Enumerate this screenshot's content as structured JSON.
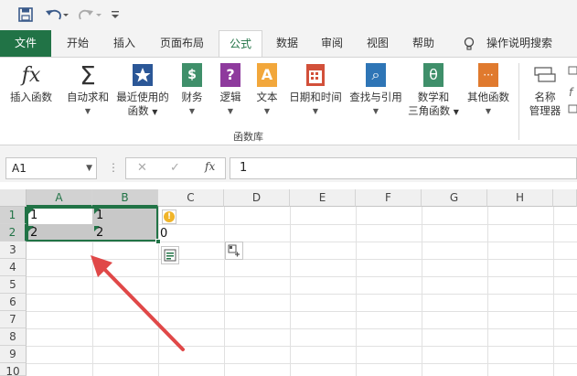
{
  "qat": {
    "save_icon": "save-icon",
    "undo_icon": "undo-icon",
    "redo_icon": "redo-icon",
    "customize_icon": "customize-qat-icon"
  },
  "tabs": {
    "file": "文件",
    "home": "开始",
    "insert": "插入",
    "page_layout": "页面布局",
    "formulas": "公式",
    "data": "数据",
    "review": "审阅",
    "view": "视图",
    "help": "帮助",
    "tell_me": "操作说明搜索"
  },
  "ribbon": {
    "insert_function": "插入函数",
    "autosum": "自动求和",
    "recent_line1": "最近使用的",
    "recent_line2": "函数",
    "financial": "财务",
    "logical": "逻辑",
    "text": "文本",
    "datetime": "日期和时间",
    "lookup": "查找与引用",
    "math_line1": "数学和",
    "math_line2": "三角函数",
    "more": "其他函数",
    "name_line1": "名称",
    "name_line2": "管理器",
    "group_label": "函数库",
    "fx_glyph": "fx",
    "sigma_glyph": "Σ",
    "financial_glyph": "$",
    "logical_glyph": "?",
    "text_glyph": "A",
    "lookup_glyph": "⌕",
    "math_glyph": "θ",
    "more_glyph": "···",
    "colors": {
      "accent": "#217346"
    }
  },
  "formula_bar": {
    "name_box": "A1",
    "dots": "⋮",
    "cancel": "✕",
    "enter": "✓",
    "fx": "fx",
    "value": "1"
  },
  "grid": {
    "columns": [
      "A",
      "B",
      "C",
      "D",
      "E",
      "F",
      "G",
      "H"
    ],
    "rows": [
      "1",
      "2",
      "3",
      "4",
      "5",
      "6",
      "7",
      "8",
      "9",
      "10"
    ],
    "cells": {
      "A1": "1",
      "B1": "1",
      "A2": "2",
      "B2": "2",
      "C2": "0"
    },
    "warning_glyph": "!"
  }
}
